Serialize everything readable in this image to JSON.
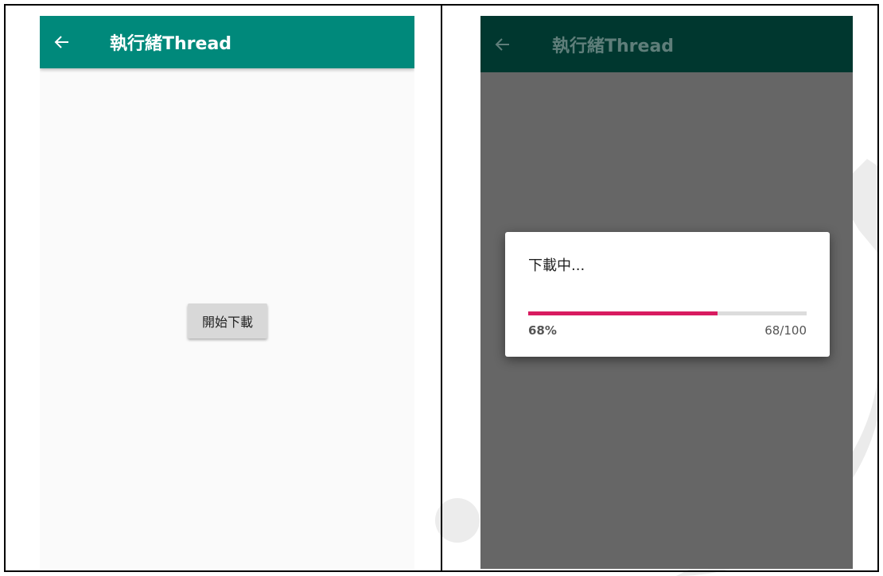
{
  "screens": {
    "left": {
      "appbar": {
        "title": "執行緒Thread",
        "color": "#00897b",
        "back_icon": "arrow-left-icon"
      },
      "start_button_label": "開始下載",
      "background": "#fafafa"
    },
    "right": {
      "appbar": {
        "title": "執行緒Thread",
        "color": "#00372f",
        "back_icon": "arrow-left-icon"
      },
      "scrim_color": "#666666",
      "dialog": {
        "title": "下載中...",
        "progress": 68,
        "max": 100,
        "percent_label": "68%",
        "count_label": "68/100",
        "accent": "#d81b60"
      }
    }
  }
}
